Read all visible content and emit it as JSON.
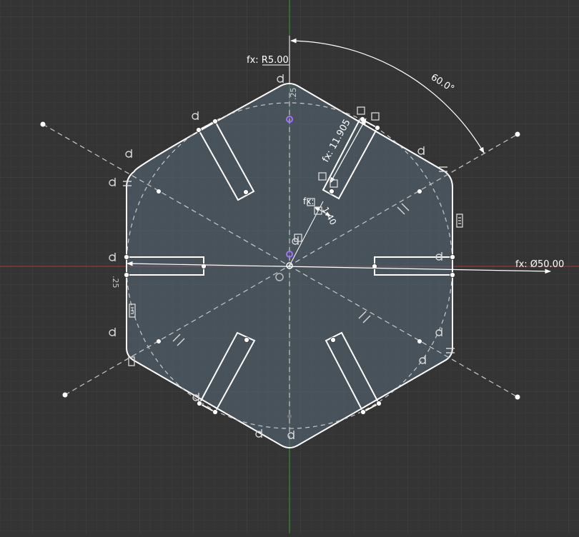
{
  "viewport": {
    "background_color": "#343434",
    "grid_minor_color": "#3c3c3c",
    "grid_major_color": "#454545",
    "x_axis_color": "#a83a3a",
    "y_axis_color": "#3a9a3a"
  },
  "sketch": {
    "profile_fill_color": "#5a6b7a",
    "line_color": "#ffffff",
    "construction_color": "#c8c8c8",
    "dimension_color": "#ffffff",
    "constraint_icon_color": "#d8d8d8",
    "center_point_color": "#a070ff",
    "shape": "rounded hexagon with six radial slots",
    "dimensions": {
      "fillet_radius": "fx: R5.00",
      "angle": "60.0°",
      "slot_length": "fx: 11.905",
      "slot_width_prefix": "fx:",
      "slot_width": "1.40",
      "diameter": "fx: Ø50.00",
      "top_offset": ".25",
      "left_offset": ".25"
    },
    "constraint_icons": [
      "tangent-icon",
      "coincident-icon",
      "parallel-icon",
      "midpoint-icon"
    ]
  }
}
